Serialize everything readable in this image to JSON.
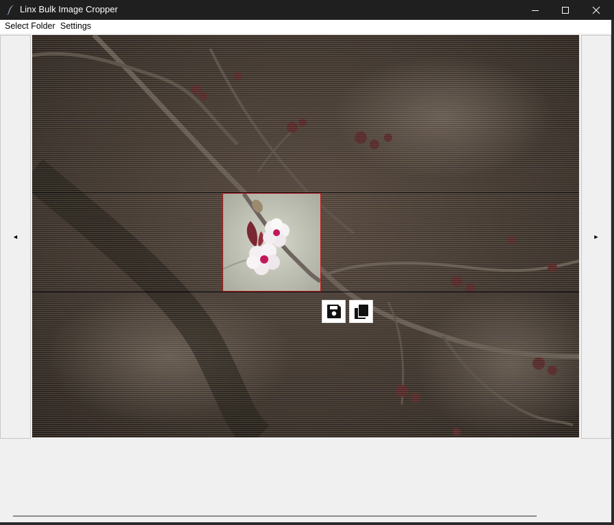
{
  "window": {
    "title": "Linx Bulk Image Cropper",
    "controls": [
      "minimize",
      "maximize",
      "close"
    ]
  },
  "menu": {
    "items": [
      {
        "label": "Select Folder"
      },
      {
        "label": "Settings"
      }
    ]
  },
  "navigation": {
    "prev_label": "◄",
    "next_label": "►"
  },
  "icons": {
    "app": "feather-icon",
    "save": "floppy-disk-icon",
    "copy": "copy-icon"
  },
  "colors": {
    "crop_border": "#c21a1a",
    "titlebar_bg": "#1f1f1f",
    "client_bg": "#f0f0f0"
  }
}
